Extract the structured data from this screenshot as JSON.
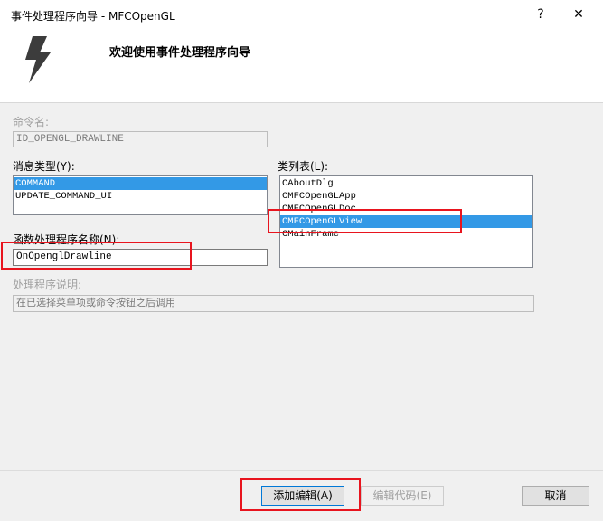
{
  "window": {
    "title": "事件处理程序向导 - MFCOpenGL",
    "help_symbol": "?",
    "close_symbol": "✕"
  },
  "header": {
    "heading": "欢迎使用事件处理程序向导",
    "icon": "lightning-bolt-icon"
  },
  "command_name": {
    "label": "命令名:",
    "value": "ID_OPENGL_DRAWLINE"
  },
  "message_type": {
    "label": "消息类型(Y):",
    "items": [
      "COMMAND",
      "UPDATE_COMMAND_UI"
    ],
    "selected": "COMMAND"
  },
  "class_list": {
    "label": "类列表(L):",
    "items": [
      "CAboutDlg",
      "CMFCOpenGLApp",
      "CMFCOpenGLDoc",
      "CMFCOpenGLView",
      "CMainFrame"
    ],
    "selected": "CMFCOpenGLView"
  },
  "handler_name": {
    "label": "函数处理程序名称(N):",
    "value": "OnOpenglDrawline"
  },
  "description": {
    "label": "处理程序说明:",
    "value": "在已选择菜单项或命令按钮之后调用"
  },
  "buttons": {
    "add_edit": "添加编辑(A)",
    "edit_code": "编辑代码(E)",
    "cancel": "取消"
  },
  "colors": {
    "highlight": "#e8141e",
    "selection": "#3399e6"
  }
}
